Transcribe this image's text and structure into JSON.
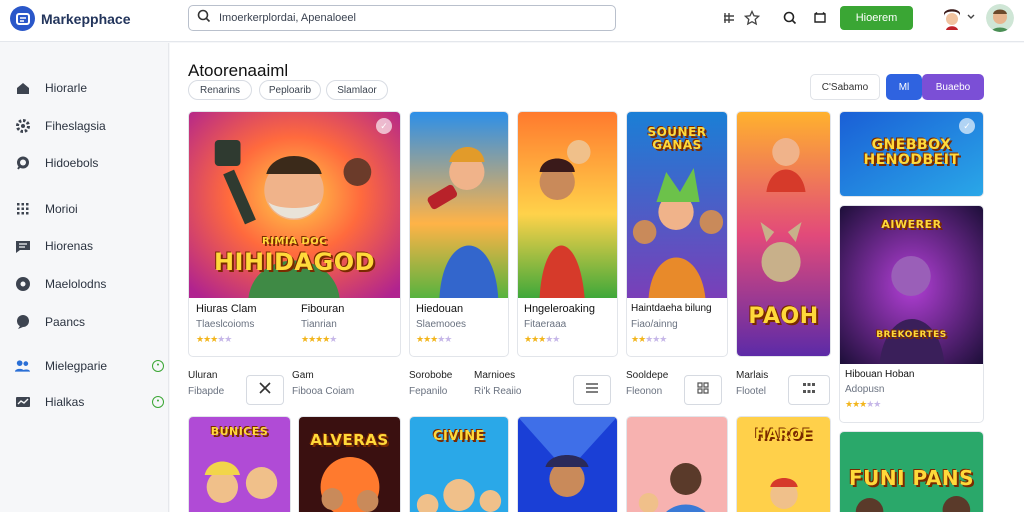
{
  "app": {
    "name": "Markepphace"
  },
  "search": {
    "value": "Imoerkerplordai, Apenaloeel"
  },
  "topbar": {
    "cta_label": "Hioerem"
  },
  "sidebar": {
    "items": [
      {
        "label": "Hiorarle",
        "icon": "home-icon"
      },
      {
        "label": "Fiheslagsia",
        "icon": "gear-icon"
      },
      {
        "label": "Hidoebols",
        "icon": "chat-icon"
      },
      {
        "label": "Morioi",
        "icon": "grid-icon"
      },
      {
        "label": "Hiorenas",
        "icon": "message-icon"
      },
      {
        "label": "Maelolodns",
        "icon": "disc-icon"
      },
      {
        "label": "Paancs",
        "icon": "comment-icon"
      },
      {
        "label": "Mielegparie",
        "icon": "users-icon",
        "badge": true
      },
      {
        "label": "Hialkas",
        "icon": "chart-icon",
        "badge": true
      }
    ]
  },
  "main": {
    "title": "Atoorenaaiml",
    "chips": [
      "Renarins",
      "Peploarib",
      "Slamlaor"
    ],
    "pills": [
      "C'Sabamo",
      "Ml",
      "Buaebo"
    ]
  },
  "cards": [
    {
      "title": "Hiuras Clam",
      "sub": "Tlaeslcoioms",
      "art": "HIHIDAGOD",
      "art_small": "RIMIA DOC",
      "rating": 3
    },
    {
      "title": "Fibouran",
      "sub": "Tianrian",
      "rating": 4
    },
    {
      "title": "Hiedouan",
      "sub": "Slaemooes",
      "rating": 3
    },
    {
      "title": "Hngeleroaking",
      "sub": "Fitaeraaa",
      "rating": 3
    },
    {
      "title": "Haintdaeha bilung",
      "sub": "Fiao/ainng",
      "art": "SOUNER GANAS",
      "rating": 2
    },
    {
      "art": "PAOH"
    },
    {
      "art": "GNEBBOX HENODBEIT"
    },
    {
      "title": "Hibouan Hoban",
      "sub": "Adopusn",
      "art": "AIWERER",
      "art_small": "BREKOERTES",
      "rating": 3
    }
  ],
  "row2": [
    {
      "title": "Uluran",
      "sub": "Fibapde"
    },
    {
      "title": "Gam",
      "sub": "Fibooa Coiam"
    },
    {
      "title": "Sorobobe",
      "sub": "Fepanilo"
    },
    {
      "title": "Marnioes",
      "sub": "Ri'k Reaiio"
    },
    {
      "title": "Sooldepe",
      "sub": "Fleonon"
    },
    {
      "title": "Marlais",
      "sub": "Flootel"
    }
  ],
  "bottom": [
    {
      "art": "BUNICES"
    },
    {
      "art": "ALVERAS"
    },
    {
      "art": "CIVINE"
    },
    {
      "art": ""
    },
    {
      "art": ""
    },
    {
      "art": "HAROE"
    },
    {
      "art": "FUNI PANS"
    }
  ],
  "colors": {
    "accent_green": "#3aa634",
    "accent_blue": "#2f63e0",
    "accent_purple": "#7b4fd6",
    "star": "#f2b51c"
  }
}
